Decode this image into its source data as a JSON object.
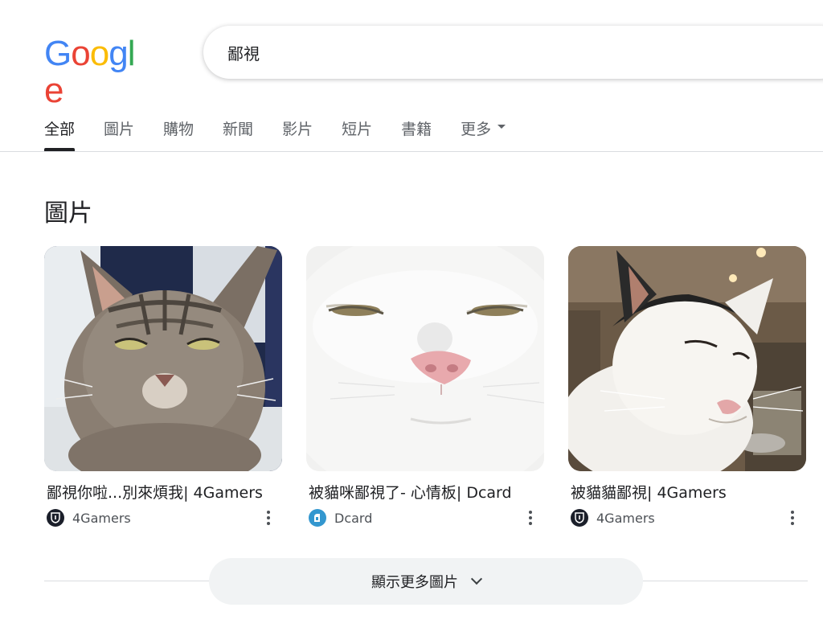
{
  "logo": {
    "letters": [
      "G",
      "o",
      "o",
      "g",
      "l",
      "e"
    ],
    "colors": [
      "#4285F4",
      "#EA4335",
      "#FBBC05",
      "#4285F4",
      "#34A853",
      "#EA4335"
    ]
  },
  "search": {
    "query": "鄙視"
  },
  "tabs": [
    {
      "label": "全部",
      "active": true
    },
    {
      "label": "圖片"
    },
    {
      "label": "購物"
    },
    {
      "label": "新聞"
    },
    {
      "label": "影片"
    },
    {
      "label": "短片"
    },
    {
      "label": "書籍"
    },
    {
      "label": "更多"
    }
  ],
  "images_section": {
    "title": "圖片",
    "results": [
      {
        "title": "鄙視你啦...別來煩我| 4Gamers",
        "source": "4Gamers",
        "favicon": "4gamers-shield-icon"
      },
      {
        "title": "被貓咪鄙視了- 心情板| Dcard",
        "source": "Dcard",
        "favicon": "dcard-icon"
      },
      {
        "title": "被貓貓鄙視| 4Gamers",
        "source": "4Gamers",
        "favicon": "4gamers-shield-icon"
      }
    ],
    "show_more_label": "顯示更多圖片"
  }
}
